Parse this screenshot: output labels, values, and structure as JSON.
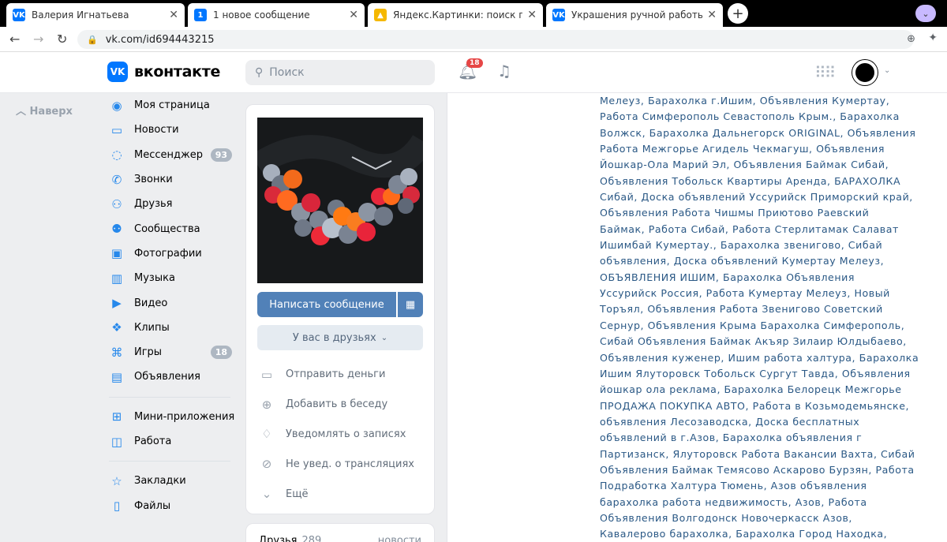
{
  "browser": {
    "tabs": [
      {
        "title": "Валерия Игнатьева",
        "icon": "vk-favicon",
        "active": true
      },
      {
        "title": "1 новое сообщение",
        "icon": "message-count-favicon",
        "badge": "1"
      },
      {
        "title": "Яндекс.Картинки: поиск по изоб",
        "icon": "image-favicon"
      },
      {
        "title": "Украшения ручной работы от m",
        "icon": "vk-favicon"
      }
    ],
    "url": "vk.com/id694443215"
  },
  "header": {
    "logo_text": "вконтакте",
    "search_placeholder": "Поиск",
    "notifications_count": "18"
  },
  "sidebar": {
    "up_label": "Наверх",
    "items": [
      {
        "label": "Моя страница",
        "icon": "user-circle-icon"
      },
      {
        "label": "Новости",
        "icon": "news-icon"
      },
      {
        "label": "Мессенджер",
        "icon": "message-icon",
        "badge": "93"
      },
      {
        "label": "Звонки",
        "icon": "phone-icon"
      },
      {
        "label": "Друзья",
        "icon": "friends-icon"
      },
      {
        "label": "Сообщества",
        "icon": "communities-icon"
      },
      {
        "label": "Фотографии",
        "icon": "photo-icon"
      },
      {
        "label": "Музыка",
        "icon": "music-icon"
      },
      {
        "label": "Видео",
        "icon": "video-icon"
      },
      {
        "label": "Клипы",
        "icon": "clips-icon"
      },
      {
        "label": "Игры",
        "icon": "games-icon",
        "badge": "18"
      },
      {
        "label": "Объявления",
        "icon": "classifieds-icon"
      }
    ],
    "items2": [
      {
        "label": "Мини-приложения",
        "icon": "apps-icon"
      },
      {
        "label": "Работа",
        "icon": "briefcase-icon"
      }
    ],
    "items3": [
      {
        "label": "Закладки",
        "icon": "star-icon"
      },
      {
        "label": "Файлы",
        "icon": "file-icon"
      }
    ]
  },
  "profile": {
    "write_message": "Написать сообщение",
    "friend_status": "У вас в друзьях",
    "actions": [
      {
        "label": "Отправить деньги",
        "icon": "money-icon"
      },
      {
        "label": "Добавить в беседу",
        "icon": "add-chat-icon"
      },
      {
        "label": "Уведомлять о записях",
        "icon": "bell-icon"
      },
      {
        "label": "Не увед. о трансляциях",
        "icon": "no-stream-icon"
      },
      {
        "label": "Ещё",
        "icon": "chevron-down-icon"
      }
    ],
    "friends_label": "Друзья",
    "friends_count": "289",
    "friends_right": "новости"
  },
  "post_lines": [
    "Мелеуз, Барахолка г.Ишим, Объявления Кумертау,",
    "Работа Симферополь Севастополь Крым., Барахолка",
    "Волжск, Барахолка Дальнегорск ORIGINAL, Объявления",
    "Работа Межгорье Агидель Чекмагуш, Объявления",
    "Йошкар-Ола Марий Эл, Объявления Баймак Сибай,",
    "Объявления Тобольск Квартиры Аренда, БАРАХОЛКА",
    "Сибай, Доска объявлений Уссурийск Приморский край,",
    "Объявления Работа Чишмы Приютово Раевский",
    "Баймак, Работа Сибай, Работа Стерлитамак Салават",
    "Ишимбай Кумертау., Барахолка звенигово, Сибай",
    "объявления, Доска объявлений Кумертау Мелеуз,",
    "ОБЪЯВЛЕНИЯ ИШИМ, Барахолка Объявления",
    "Уссурийск Россия, Работа Кумертау Мелеуз, Новый",
    "Торъял, Объявления Работа Звенигово Советский",
    "Сернур, Объявления Крыма Барахолка Симферополь,",
    "Сибай Объявления Баймак Акъяр Зилаир Юлдыбаево,",
    "Объявления куженер, Ишим работа халтура, Барахолка",
    "Ишим Ялуторовск Тобольск Сургут Тавда, Объявления",
    "йошкар ола реклама, Барахолка Белорецк Межгорье",
    "ПРОДАЖА ПОКУПКА АВТО, Работа в Козьмодемьянске,",
    "объявления Лесозаводска, Доска бесплатных",
    "объявлений в г.Азов, Барахолка объявления г",
    "Партизанск, Ялуторовск Работа Вакансии Вахта, Сибай",
    "Объявления Баймак Темясово Аскарово Бурзян, Работа",
    "Подработка Халтура Тюмень, Азов объявления",
    "барахолка работа недвижимость, Азов, Работа",
    "Объявления Волгодонск Новочеркасск Азов,",
    "Кавалерово барахолка, Барахолка Город Находка,"
  ]
}
